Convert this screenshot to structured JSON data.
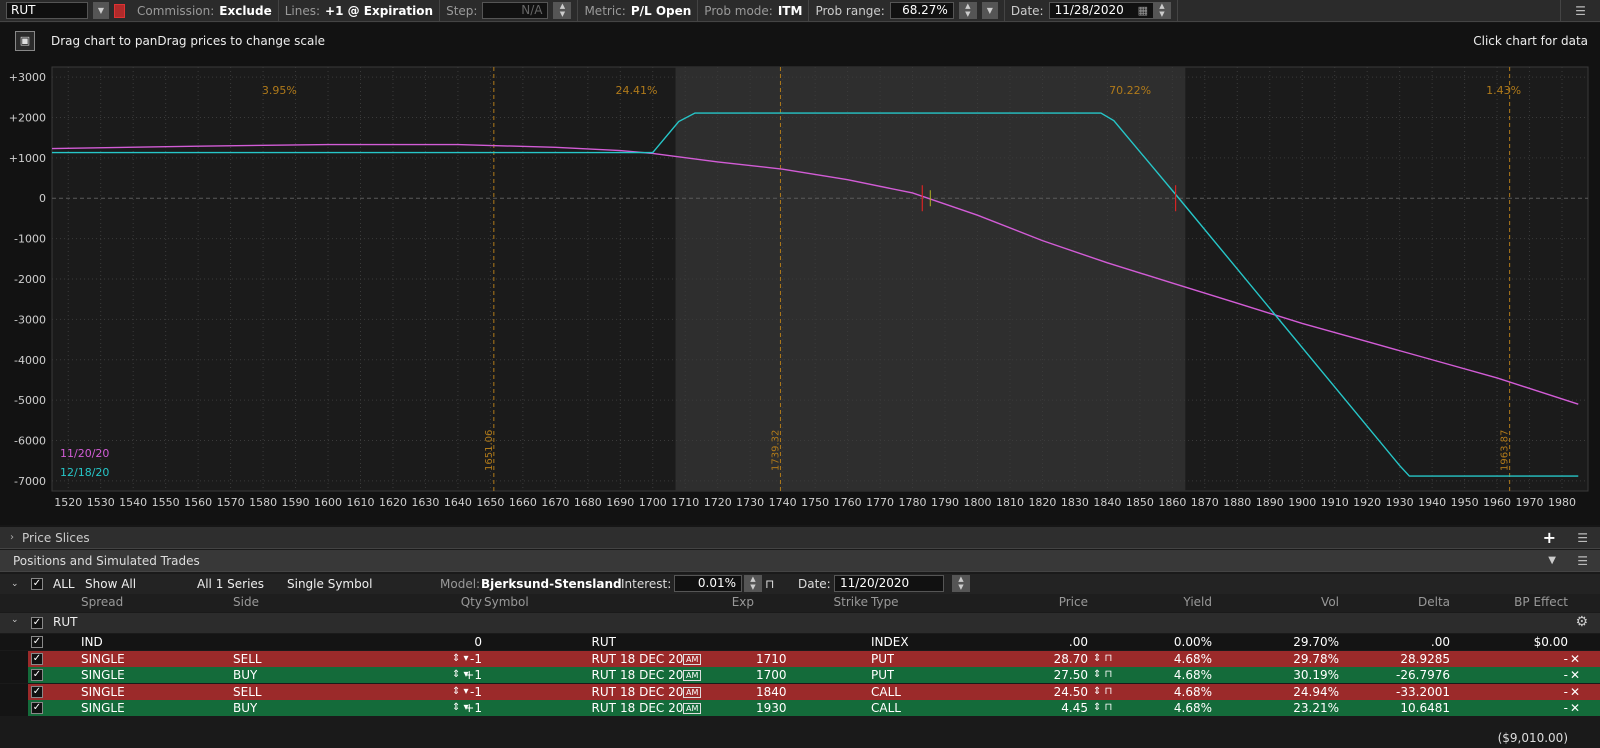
{
  "toolbar": {
    "symbol": "RUT",
    "commission_label": "Commission:",
    "commission_value": "Exclude",
    "lines_label": "Lines:",
    "lines_value": "+1 @ Expiration",
    "step_label": "Step:",
    "step_value": "N/A",
    "metric_label": "Metric:",
    "metric_value": "P/L Open",
    "probmode_label": "Prob mode:",
    "probmode_value": "ITM",
    "probrange_label": "Prob range:",
    "probrange_value": "68.27%",
    "date_label": "Date:",
    "date_value": "11/28/2020"
  },
  "chart_header": {
    "hint": "Drag chart to panDrag prices to change scale",
    "click_hint": "Click chart for data"
  },
  "chart_data": {
    "type": "line",
    "xlim": [
      1515,
      1988
    ],
    "ylim": [
      -7250,
      3250
    ],
    "x_ticks": [
      1520,
      1530,
      1540,
      1550,
      1560,
      1570,
      1580,
      1590,
      1600,
      1610,
      1620,
      1630,
      1640,
      1650,
      1660,
      1670,
      1680,
      1690,
      1700,
      1710,
      1720,
      1730,
      1740,
      1750,
      1760,
      1770,
      1780,
      1790,
      1800,
      1810,
      1820,
      1830,
      1840,
      1850,
      1860,
      1870,
      1880,
      1890,
      1900,
      1910,
      1920,
      1930,
      1940,
      1950,
      1960,
      1970,
      1980
    ],
    "y_ticks": [
      {
        "v": 3000,
        "t": "+3000"
      },
      {
        "v": 2000,
        "t": "+2000"
      },
      {
        "v": 1000,
        "t": "+1000"
      },
      {
        "v": 0,
        "t": "0"
      },
      {
        "v": -1000,
        "t": "-1000"
      },
      {
        "v": -2000,
        "t": "-2000"
      },
      {
        "v": -3000,
        "t": "-3000"
      },
      {
        "v": -4000,
        "t": "-4000"
      },
      {
        "v": -5000,
        "t": "-5000"
      },
      {
        "v": -6000,
        "t": "-6000"
      },
      {
        "v": -7000,
        "t": "-7000"
      }
    ],
    "prob_band": [
      1707,
      1864
    ],
    "marker_lines": [
      {
        "x": 1651.06,
        "label": "1651.06"
      },
      {
        "x": 1739.32,
        "label": "1739.32"
      },
      {
        "x": 1963.87,
        "label": "1963.87"
      }
    ],
    "prob_labels": [
      {
        "x": 1585,
        "text": "3.95%"
      },
      {
        "x": 1695,
        "text": "24.41%"
      },
      {
        "x": 1847,
        "text": "70.22%"
      },
      {
        "x": 1962,
        "text": "1.43%"
      }
    ],
    "series": [
      {
        "name": "11/20/20",
        "color": "#d25cd6",
        "x": [
          1515,
          1560,
          1600,
          1640,
          1670,
          1690,
          1700,
          1720,
          1740,
          1760,
          1780,
          1800,
          1820,
          1840,
          1860,
          1880,
          1900,
          1920,
          1940,
          1960,
          1985
        ],
        "y": [
          1230,
          1290,
          1330,
          1330,
          1260,
          1180,
          1110,
          900,
          720,
          460,
          130,
          -420,
          -1050,
          -1600,
          -2100,
          -2600,
          -3100,
          -3550,
          -4000,
          -4450,
          -5100
        ]
      },
      {
        "name": "12/18/20",
        "color": "#26c6c8",
        "x": [
          1515,
          1600,
          1700,
          1708,
          1713,
          1838,
          1842,
          1862,
          1930,
          1933,
          1985
        ],
        "y": [
          1130,
          1130,
          1130,
          1900,
          2110,
          2110,
          1920,
          0,
          -6620,
          -6880,
          -6880
        ]
      }
    ],
    "breakevens": [
      1783,
      1861
    ]
  },
  "price_slices": {
    "label": "Price Slices"
  },
  "positions": {
    "title": "Positions and Simulated Trades",
    "controls": {
      "all_label": "ALL",
      "show": "Show All",
      "series": "All 1 Series",
      "symbol_mode": "Single Symbol",
      "model_label": "Model:",
      "model_value": "Bjerksund-Stensland",
      "interest_label": "Interest:",
      "interest_value": "0.01%",
      "date_label": "Date:",
      "date_value": "11/20/2020"
    },
    "columns": [
      "Spread",
      "Side",
      "Qty",
      "Symbol",
      "Exp",
      "Strike",
      "Type",
      "Price",
      "Yield",
      "Vol",
      "Delta",
      "BP Effect"
    ],
    "group": "RUT",
    "rows": [
      {
        "spread": "IND",
        "side": "",
        "qty": "0",
        "symbol": "RUT",
        "exp": "",
        "am": "",
        "strike": "",
        "type": "INDEX",
        "price": ".00",
        "yield": "0.00%",
        "vol": "29.70%",
        "delta": ".00",
        "bp": "$0.00",
        "color": "none"
      },
      {
        "spread": "SINGLE",
        "side": "SELL",
        "qty": "-1",
        "symbol": "RUT",
        "exp": "18 DEC 20",
        "am": "AM",
        "strike": "1710",
        "type": "PUT",
        "price": "28.70",
        "yield": "4.68%",
        "vol": "29.78%",
        "delta": "28.9285",
        "bp": "-",
        "color": "red"
      },
      {
        "spread": "SINGLE",
        "side": "BUY",
        "qty": "+1",
        "symbol": "RUT",
        "exp": "18 DEC 20",
        "am": "AM",
        "strike": "1700",
        "type": "PUT",
        "price": "27.50",
        "yield": "4.68%",
        "vol": "30.19%",
        "delta": "-26.7976",
        "bp": "-",
        "color": "green"
      },
      {
        "spread": "SINGLE",
        "side": "SELL",
        "qty": "-1",
        "symbol": "RUT",
        "exp": "18 DEC 20",
        "am": "AM",
        "strike": "1840",
        "type": "CALL",
        "price": "24.50",
        "yield": "4.68%",
        "vol": "24.94%",
        "delta": "-33.2001",
        "bp": "-",
        "color": "red"
      },
      {
        "spread": "SINGLE",
        "side": "BUY",
        "qty": "+1",
        "symbol": "RUT",
        "exp": "18 DEC 20",
        "am": "AM",
        "strike": "1930",
        "type": "CALL",
        "price": "4.45",
        "yield": "4.68%",
        "vol": "23.21%",
        "delta": "10.6481",
        "bp": "-",
        "color": "green"
      }
    ],
    "total_bp": "($9,010.00)"
  }
}
